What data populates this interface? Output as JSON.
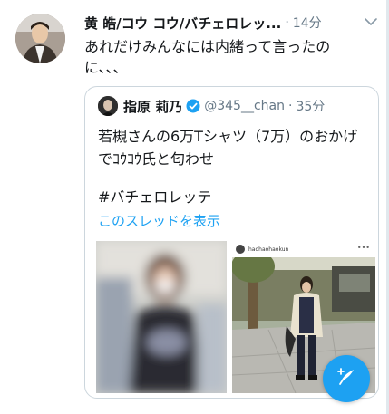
{
  "tweet": {
    "author_name": "黄 皓/コウ コウ/バチェロレッ...",
    "separator": "·",
    "time": "14分",
    "text": "あれだけみんなには内緒って言ったのに、、、"
  },
  "quoted": {
    "author_name": "指原 莉乃",
    "handle": "@345__chan",
    "separator": "·",
    "time": "35分",
    "text": "若槻さんの6万Tシャツ（7万）のおかげでｺｳｺｳ氏と匂わせ",
    "hashtag": "#バチェロレッテ",
    "thread_link": "このスレッドを表示",
    "image_right_username": "haohaohaokun"
  },
  "icons": {
    "menu": "chevron-down-icon",
    "verified": "verified-badge-icon",
    "compose": "compose-tweet-icon"
  },
  "colors": {
    "accent": "#1da1f2",
    "secondary_text": "#657786",
    "border": "#ccd6dd"
  }
}
